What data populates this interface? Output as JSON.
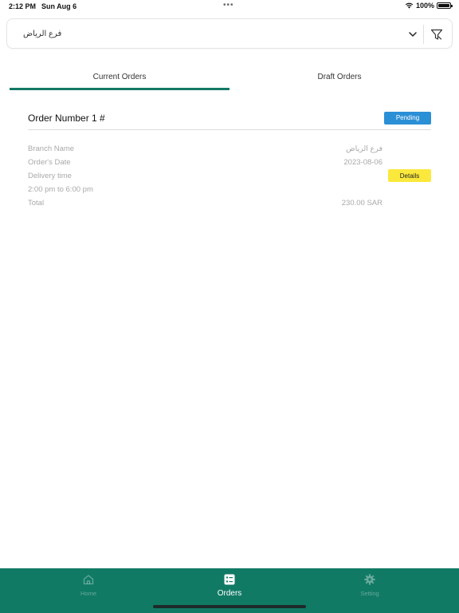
{
  "status_bar": {
    "time": "2:12 PM",
    "date": "Sun Aug 6",
    "battery": "100%",
    "battery_level": 1.0
  },
  "branch_selector": {
    "selected": "فرع الرياض",
    "chevron_icon": "chevron-down-icon",
    "filter_icon": "filter-icon"
  },
  "tabs": [
    {
      "label": "Current Orders",
      "active": true
    },
    {
      "label": "Draft Orders",
      "active": false
    }
  ],
  "order": {
    "title": "Order Number  1 #",
    "status": "Pending",
    "details_label": "Details",
    "rows": [
      {
        "label": "Branch Name",
        "value": "فرع الرياض"
      },
      {
        "label": "Order's Date",
        "value": "2023-08-06"
      },
      {
        "label": "Delivery time",
        "value": ""
      },
      {
        "label": "2:00 pm to 6:00 pm",
        "value": ""
      },
      {
        "label": "Total",
        "value": "230.00 SAR"
      }
    ]
  },
  "bottom_nav": [
    {
      "label": "Home",
      "icon": "home-icon",
      "active": false
    },
    {
      "label": "Orders",
      "icon": "orders-icon",
      "active": true
    },
    {
      "label": "Setting",
      "icon": "gear-icon",
      "active": false
    }
  ],
  "colors": {
    "primary": "#117a65",
    "pending_badge": "#2b8fd6",
    "details_button": "#fbe83c"
  }
}
